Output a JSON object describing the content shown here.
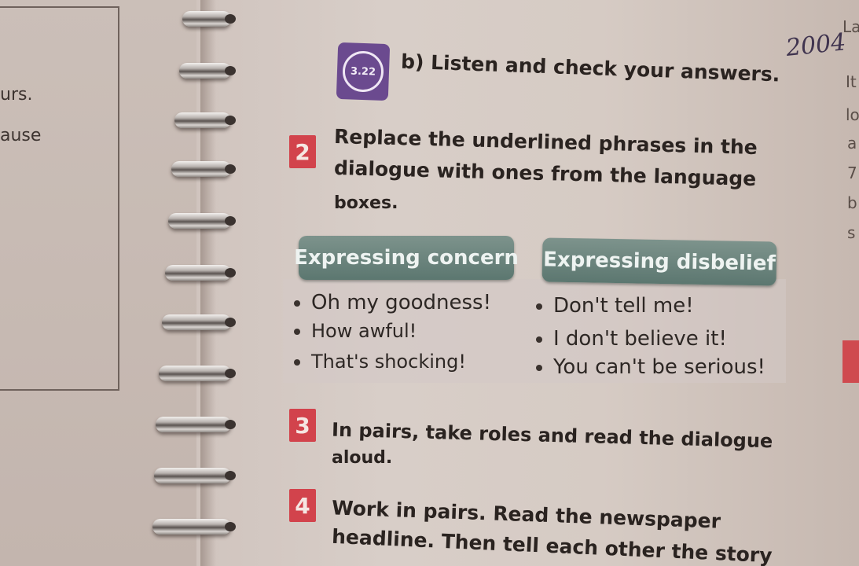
{
  "left_page": {
    "fragments": [
      "urs.",
      "ause"
    ]
  },
  "exercise_1b": {
    "audio_track": "3.22",
    "text": "b) Listen and check your answers."
  },
  "exercise_2": {
    "number": "2",
    "lines": [
      "Replace the underlined phrases in the",
      "dialogue with ones from the language",
      "boxes."
    ]
  },
  "box_concern": {
    "title": "Expressing concern",
    "items": [
      "Oh my goodness!",
      "How awful!",
      "That's shocking!"
    ]
  },
  "box_disbelief": {
    "title": "Expressing disbelief",
    "items": [
      "Don't tell me!",
      "I don't believe it!",
      "You can't be serious!"
    ]
  },
  "exercise_3": {
    "number": "3",
    "lines": [
      "In pairs, take roles and read the dialogue",
      "aloud."
    ]
  },
  "exercise_4": {
    "number": "4",
    "lines": [
      "Work in pairs. Read the newspaper",
      "headline. Then tell each other the story"
    ]
  },
  "handwriting": {
    "text": "2004"
  },
  "right_edge": {
    "letters": [
      "La",
      "It",
      "lo",
      "a",
      "7",
      "b",
      "s"
    ]
  },
  "colors": {
    "audio_badge": "#6b4a8f",
    "number_badge": "#d2434c",
    "box_header": "#5c7770"
  }
}
